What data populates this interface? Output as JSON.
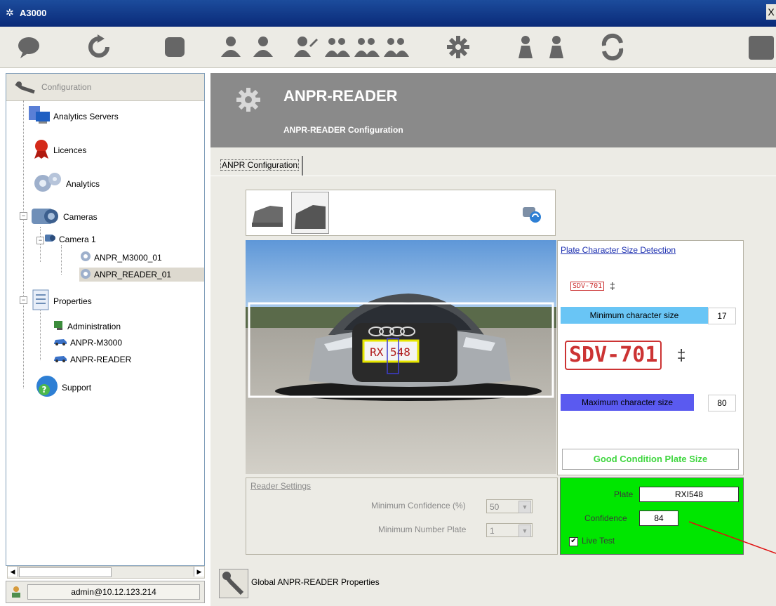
{
  "window": {
    "title": "A3000",
    "close_label": "X"
  },
  "toolbar": {
    "buttons": [
      "chat-icon",
      "refresh-icon",
      "stop-icon",
      "user-add-icon",
      "user-remove-icon",
      "user-edit-icon",
      "group-icon",
      "group-add-icon",
      "group-edit-icon",
      "gear-icon",
      "person-icon",
      "person-alt-icon",
      "sync-icon",
      "document-icon"
    ]
  },
  "tree": {
    "header": "Configuration",
    "items": [
      {
        "label": "Analytics Servers"
      },
      {
        "label": "Licences"
      },
      {
        "label": "Analytics"
      },
      {
        "label": "Cameras"
      },
      {
        "label": "Camera 1"
      },
      {
        "label": "ANPR_M3000_01"
      },
      {
        "label": "ANPR_READER_01"
      },
      {
        "label": "Properties"
      },
      {
        "label": "Administration"
      },
      {
        "label": "ANPR-M3000"
      },
      {
        "label": "ANPR-READER"
      },
      {
        "label": "Support"
      }
    ]
  },
  "status": {
    "user": "admin@10.12.123.214"
  },
  "header": {
    "title": "ANPR-READER",
    "subtitle": "ANPR-READER Configuration"
  },
  "tab": {
    "label": "ANPR Configuration"
  },
  "video": {
    "plate_text": "RX 548"
  },
  "size_detection": {
    "title": "Plate Character Size Detection",
    "small_sample": "SDV-701",
    "big_sample": "SDV-701",
    "min_label": "Minimum character size",
    "min_value": "17",
    "max_label": "Maximum character size",
    "max_value": "80",
    "condition": "Good Condition Plate Size",
    "colors": {
      "min_bar": "#69c5f5",
      "max_bar": "#5a5af0",
      "condition": "#3fd63f"
    }
  },
  "reader": {
    "title": "Reader Settings",
    "min_conf_label": "Minimum Confidence (%)",
    "min_conf_value": "50",
    "min_plate_label": "Minimum Number Plate",
    "min_plate_value": "1"
  },
  "result": {
    "plate_label": "Plate",
    "plate_value": "RXI548",
    "confidence_label": "Confidence",
    "confidence_value": "84",
    "live_test_label": "Live Test",
    "live_test_checked": "✔",
    "bg_color": "#00e600"
  },
  "global": {
    "label": "Global ANPR-READER Properties"
  }
}
